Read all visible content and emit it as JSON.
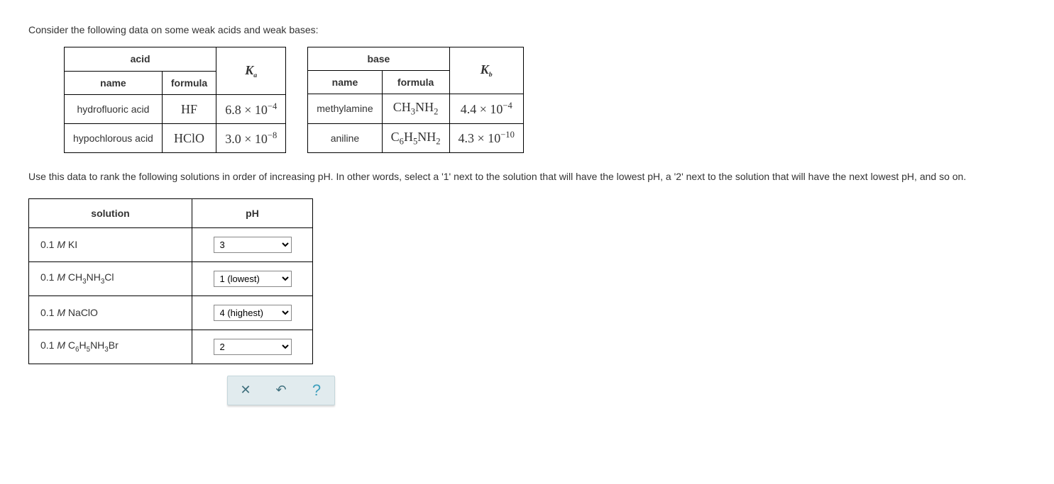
{
  "intro": "Consider the following data on some weak acids and weak bases:",
  "acid_table": {
    "header_group": "acid",
    "header_ka": "K",
    "header_ka_sub": "a",
    "col_name": "name",
    "col_formula": "formula",
    "rows": [
      {
        "name": "hydrofluoric acid",
        "formula": "HF",
        "k_coeff": "6.8",
        "k_exp": "−4"
      },
      {
        "name": "hypochlorous acid",
        "formula": "HClO",
        "k_coeff": "3.0",
        "k_exp": "−8"
      }
    ]
  },
  "base_table": {
    "header_group": "base",
    "header_kb": "K",
    "header_kb_sub": "b",
    "col_name": "name",
    "col_formula": "formula",
    "rows": [
      {
        "name": "methylamine",
        "formula_html": "CH3NH2",
        "f_parts": [
          "CH",
          "3",
          "NH",
          "2"
        ],
        "k_coeff": "4.4",
        "k_exp": "−4"
      },
      {
        "name": "aniline",
        "formula_html": "C6H5NH2",
        "f_parts": [
          "C",
          "6",
          "H",
          "5",
          "NH",
          "2"
        ],
        "k_coeff": "4.3",
        "k_exp": "−10"
      }
    ]
  },
  "instructions": "Use this data to rank the following solutions in order of increasing pH. In other words, select a '1' next to the solution that will have the lowest pH, a '2' next to the solution that will have the next lowest pH, and so on.",
  "answer_table": {
    "col_solution": "solution",
    "col_ph": "pH",
    "rows": [
      {
        "label_plain": "0.1 M KI",
        "label_parts": [
          [
            "0.1 ",
            false
          ],
          [
            "M",
            true
          ],
          [
            " KI",
            false
          ]
        ],
        "selected": "3"
      },
      {
        "label_plain": "0.1 M CH3NH3Cl",
        "label_parts": [
          [
            "0.1 ",
            false
          ],
          [
            "M",
            true
          ],
          [
            " CH",
            false
          ],
          [
            "3",
            "sub"
          ],
          [
            "NH",
            false
          ],
          [
            "3",
            "sub"
          ],
          [
            "Cl",
            false
          ]
        ],
        "selected": "1 (lowest)"
      },
      {
        "label_plain": "0.1 M NaClO",
        "label_parts": [
          [
            "0.1 ",
            false
          ],
          [
            "M",
            true
          ],
          [
            " NaClO",
            false
          ]
        ],
        "selected": "4 (highest)"
      },
      {
        "label_plain": "0.1 M C6H5NH3Br",
        "label_parts": [
          [
            "0.1 ",
            false
          ],
          [
            "M",
            true
          ],
          [
            " C",
            false
          ],
          [
            "6",
            "sub"
          ],
          [
            "H",
            false
          ],
          [
            "5",
            "sub"
          ],
          [
            "NH",
            false
          ],
          [
            "3",
            "sub"
          ],
          [
            "Br",
            false
          ]
        ],
        "selected": "2"
      }
    ],
    "options": [
      "1 (lowest)",
      "2",
      "3",
      "4 (highest)"
    ]
  },
  "toolbar": {
    "clear_title": "Clear",
    "reset_title": "Reset",
    "help_title": "Help"
  }
}
